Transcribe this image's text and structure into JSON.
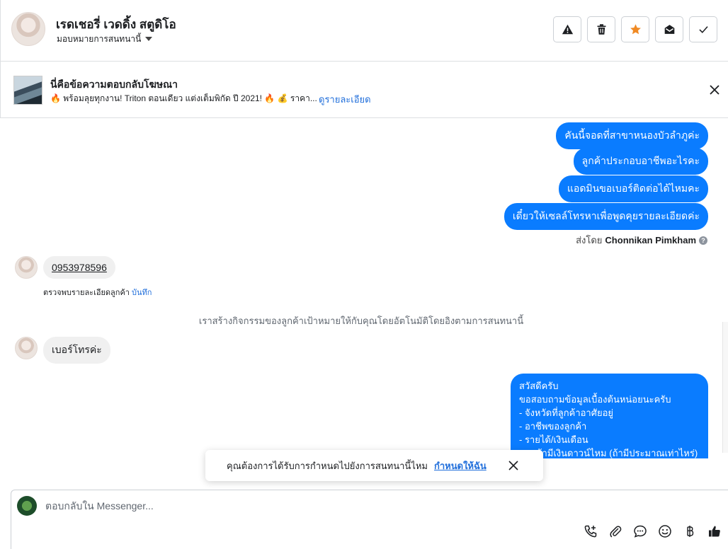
{
  "header": {
    "contact_name": "เรดเชอรี่ เวดดิ้ง สตูดิโอ",
    "assign_label": "มอบหมายการสนทนานี้",
    "actions": [
      {
        "name": "mark-spam-button",
        "icon": "warning-icon"
      },
      {
        "name": "delete-button",
        "icon": "trash-icon"
      },
      {
        "name": "star-button",
        "icon": "star-icon",
        "color": "#f08a24"
      },
      {
        "name": "mark-unread-button",
        "icon": "envelope-open-icon"
      },
      {
        "name": "mark-done-button",
        "icon": "check-icon"
      }
    ]
  },
  "ad_reply": {
    "title": "นี่คือข้อความตอบกลับโฆษณา",
    "text": "🔥 พร้อมลุยทุกงาน! Triton ตอนเดียว แต่งเต็มพิกัด ปี 2021! 🔥 💰 ราคา...",
    "details_link": "ดูรายละเอียด"
  },
  "messages": {
    "outgoing_1": "คันนี้จอดที่สาขาหนองบัวลำภูค่ะ",
    "outgoing_2": "ลูกค้าประกอบอาชีพอะไรคะ",
    "outgoing_3": "แอดมินขอเบอร์ติดต่อได้ไหมคะ",
    "outgoing_4": "เดี๋ยวให้เซลล์โทรหาเพื่อพูดคุยรายละเอียดค่ะ",
    "sent_by_prefix": "ส่งโดย",
    "sent_by_name": "Chonnikan Pimkham",
    "incoming_phone": "0953978596",
    "phone_note": "ตรวจพบรายละเอียดลูกค้า",
    "phone_note_link": "บันทึก",
    "system_note": "เราสร้างกิจกรรมของลูกค้าเป้าหมายให้กับคุณโดยอัตโนมัติโดยอิงตามการสนทนานี้",
    "incoming_2": "เบอร์โทรค่ะ",
    "outgoing_long": [
      "สวัสดีครับ",
      "ขอสอบถามข้อมูลเบื้องต้นหน่อยนะครับ",
      "- จังหวัดที่ลูกค้าอาศัยอยู่",
      "- อาชีพของลูกค้า",
      "- รายได้/เงินเดือน",
      "- ลูกค้ามีเงินดาวน์ไหม (ถ้ามีประมาณเท่าไหร่)"
    ]
  },
  "toast": {
    "text": "คุณต้องการได้รับการกำหนดไปยังการสนทนานี้ไหม",
    "link": "กำหนดให้ฉัน"
  },
  "composer": {
    "placeholder": "ตอบกลับใน Messenger...",
    "tools": [
      "phone-add-icon",
      "paperclip-icon",
      "chat-bubble-icon",
      "smiley-icon",
      "baht-icon",
      "thumbs-up-icon"
    ]
  },
  "colors": {
    "accent": "#0a7cff",
    "link": "#216fdb",
    "star": "#f08a24"
  }
}
